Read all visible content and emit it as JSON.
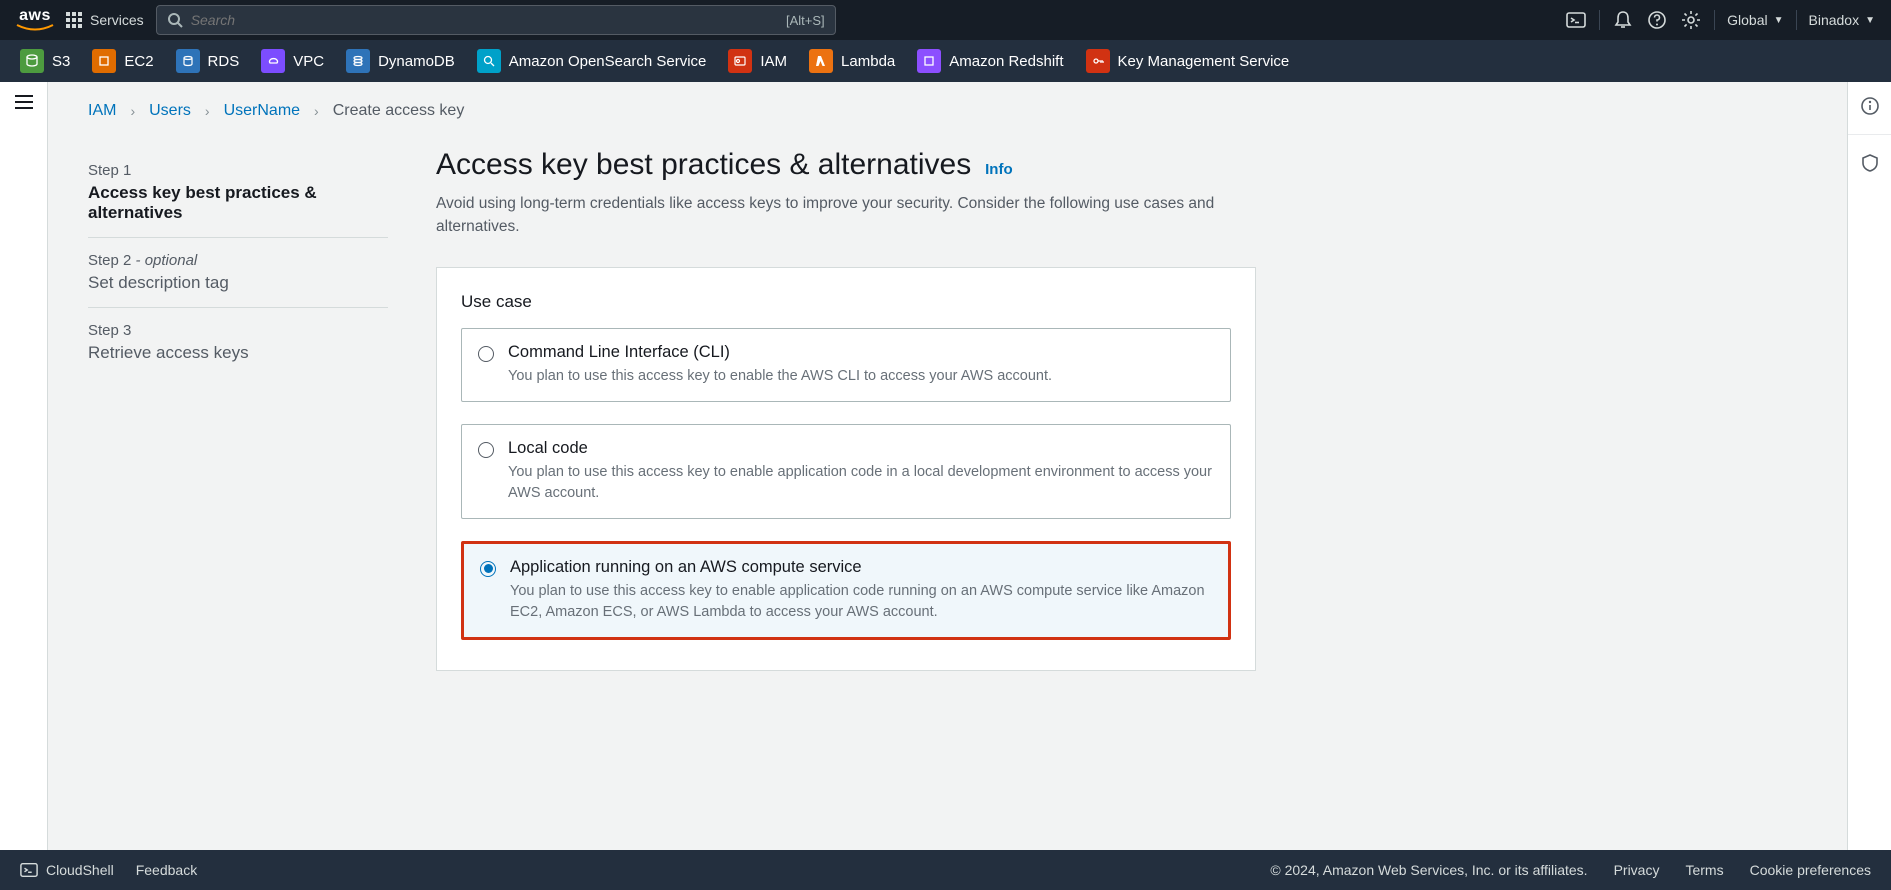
{
  "top": {
    "services_label": "Services",
    "search_placeholder": "Search",
    "search_kbd": "[Alt+S]",
    "region": "Global",
    "account": "Binadox"
  },
  "svcnav": [
    {
      "label": "S3"
    },
    {
      "label": "EC2"
    },
    {
      "label": "RDS"
    },
    {
      "label": "VPC"
    },
    {
      "label": "DynamoDB"
    },
    {
      "label": "Amazon OpenSearch Service"
    },
    {
      "label": "IAM"
    },
    {
      "label": "Lambda"
    },
    {
      "label": "Amazon Redshift"
    },
    {
      "label": "Key Management Service"
    }
  ],
  "breadcrumbs": {
    "0": "IAM",
    "1": "Users",
    "2": "UserName",
    "3": "Create access key"
  },
  "wizard": {
    "step1_label": "Step 1",
    "step1_title": "Access key best practices & alternatives",
    "step2_label": "Step 2 ",
    "step2_opt": "- optional",
    "step2_title": "Set description tag",
    "step3_label": "Step 3",
    "step3_title": "Retrieve access keys"
  },
  "main": {
    "heading": "Access key best practices & alternatives",
    "info": "Info",
    "subtitle": "Avoid using long-term credentials like access keys to improve your security. Consider the following use cases and alternatives.",
    "usecase_heading": "Use case",
    "options": [
      {
        "title": "Command Line Interface (CLI)",
        "desc": "You plan to use this access key to enable the AWS CLI to access your AWS account."
      },
      {
        "title": "Local code",
        "desc": "You plan to use this access key to enable application code in a local development environment to access your AWS account."
      },
      {
        "title": "Application running on an AWS compute service",
        "desc": "You plan to use this access key to enable application code running on an AWS compute service like Amazon EC2, Amazon ECS, or AWS Lambda to access your AWS account."
      }
    ]
  },
  "footer": {
    "cloudshell": "CloudShell",
    "feedback": "Feedback",
    "copy": "© 2024, Amazon Web Services, Inc. or its affiliates.",
    "privacy": "Privacy",
    "terms": "Terms",
    "cookies": "Cookie preferences"
  }
}
